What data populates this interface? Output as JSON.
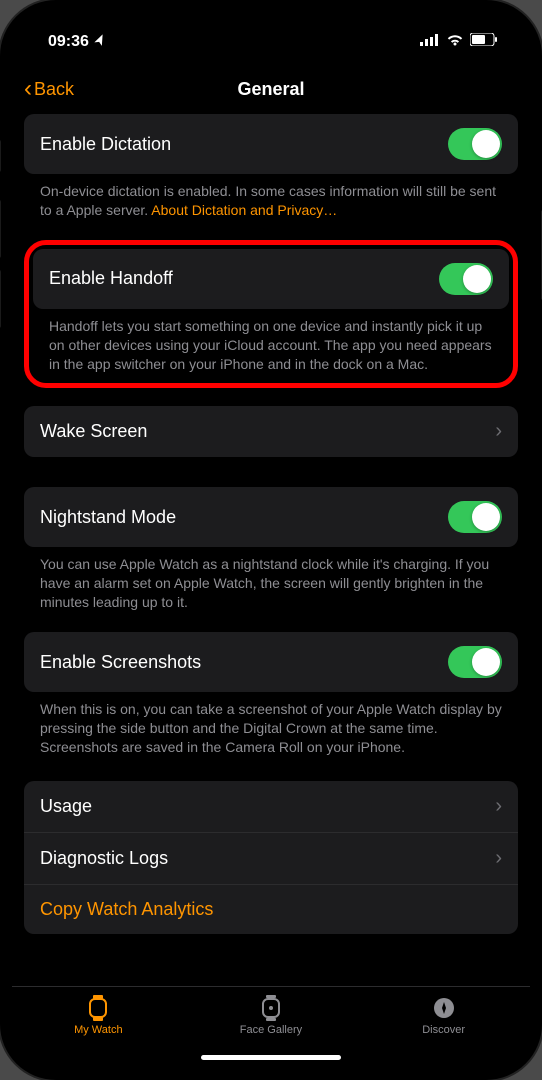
{
  "status": {
    "time": "09:36",
    "locationGlyph": "➤"
  },
  "nav": {
    "back": "Back",
    "title": "General"
  },
  "rows": {
    "dictation": {
      "label": "Enable Dictation",
      "desc": "On-device dictation is enabled. In some cases information will still be sent to a Apple server. ",
      "link": "About Dictation and Privacy…",
      "on": true
    },
    "handoff": {
      "label": "Enable Handoff",
      "desc": "Handoff lets you start something on one device and instantly pick it up on other devices using your iCloud account. The app you need appears in the app switcher on your iPhone and in the dock on a Mac.",
      "on": true
    },
    "wake": {
      "label": "Wake Screen"
    },
    "nightstand": {
      "label": "Nightstand Mode",
      "desc": "You can use Apple Watch as a nightstand clock while it's charging. If you have an alarm set on Apple Watch, the screen will gently brighten in the minutes leading up to it.",
      "on": true
    },
    "screenshots": {
      "label": "Enable Screenshots",
      "desc": "When this is on, you can take a screenshot of your Apple Watch display by pressing the side button and the Digital Crown at the same time. Screenshots are saved in the Camera Roll on your iPhone.",
      "on": true
    },
    "usage": {
      "label": "Usage"
    },
    "diag": {
      "label": "Diagnostic Logs"
    },
    "copy": {
      "label": "Copy Watch Analytics"
    }
  },
  "tabs": {
    "mywatch": "My Watch",
    "gallery": "Face Gallery",
    "discover": "Discover"
  }
}
